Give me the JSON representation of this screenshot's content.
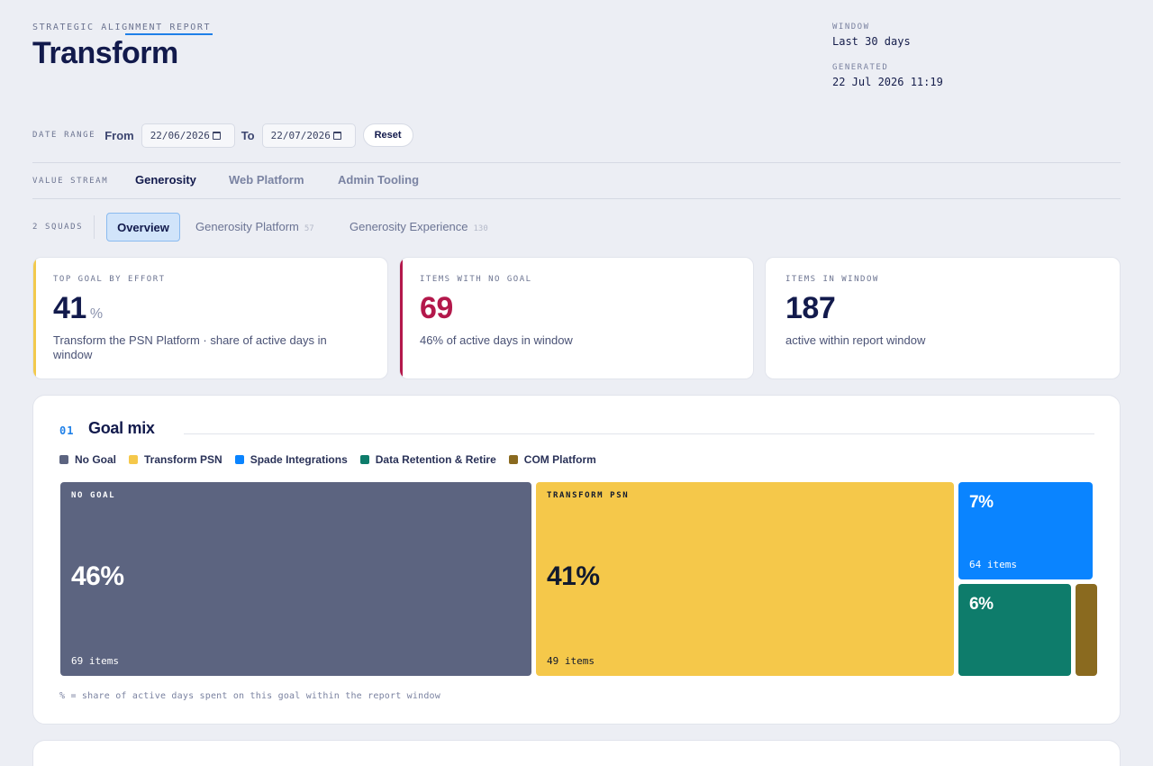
{
  "header": {
    "eyebrow": "STRATEGIC ALIGNMENT REPORT",
    "title": "Transform",
    "window_label": "WINDOW",
    "window_value": "Last 30 days",
    "generated_label": "GENERATED",
    "generated_value": "22 Jul 2026 11:19"
  },
  "date_range": {
    "label": "DATE RANGE",
    "from_label": "From",
    "from_value": "22/06/2026",
    "to_label": "To",
    "to_value": "22/07/2026",
    "reset_label": "Reset"
  },
  "value_stream": {
    "label": "VALUE STREAM",
    "tabs": [
      {
        "label": "Generosity",
        "active": true
      },
      {
        "label": "Web Platform",
        "active": false
      },
      {
        "label": "Admin Tooling",
        "active": false
      }
    ]
  },
  "squads": {
    "label": "2 SQUADS",
    "overview_label": "Overview",
    "tabs": [
      {
        "label": "Generosity Platform",
        "count": "57"
      },
      {
        "label": "Generosity Experience",
        "count": "130"
      }
    ]
  },
  "cards": [
    {
      "label": "TOP GOAL BY EFFORT",
      "value": "41",
      "unit": "%",
      "desc": "Transform the PSN Platform · share of active days in window",
      "accent": "#f2c94c",
      "value_color": "#121a4c"
    },
    {
      "label": "ITEMS WITH NO GOAL",
      "value": "69",
      "unit": "",
      "desc": "46% of active days in window",
      "accent": "#b3184b",
      "value_color": "#b3184b"
    },
    {
      "label": "ITEMS IN WINDOW",
      "value": "187",
      "unit": "",
      "desc": "active within report window",
      "accent": "#ffffff",
      "value_color": "#121a4c"
    }
  ],
  "goal_mix": {
    "number": "01",
    "title": "Goal mix",
    "legend": [
      {
        "label": "No Goal",
        "color": "#5c6480"
      },
      {
        "label": "Transform PSN",
        "color": "#f5c84a"
      },
      {
        "label": "Spade Integrations",
        "color": "#0a84ff"
      },
      {
        "label": "Data Retention & Retire",
        "color": "#0e7c6b"
      },
      {
        "label": "COM Platform",
        "color": "#8a6a1f"
      }
    ],
    "tiles": {
      "no_goal": {
        "label": "NO GOAL",
        "pct": "46%",
        "items": "69 items"
      },
      "transform": {
        "label": "TRANSFORM PSN",
        "pct": "41%",
        "items": "49 items"
      },
      "spade": {
        "pct": "7%",
        "items": "64 items"
      },
      "data": {
        "pct": "6%"
      }
    },
    "footnote": "% = share of active days spent on this goal within the report window"
  }
}
